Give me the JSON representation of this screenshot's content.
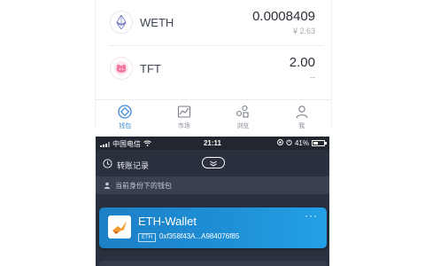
{
  "assets": [
    {
      "symbol": "WETH",
      "icon": "ethereum-icon",
      "amount": "0.0008409",
      "fiat": "¥ 2.63"
    },
    {
      "symbol": "TFT",
      "icon": "tft-token-icon",
      "amount": "2.00",
      "fiat": "--"
    }
  ],
  "tabbar": {
    "items": [
      {
        "label": "钱包",
        "icon": "wallet-icon",
        "active": true
      },
      {
        "label": "市场",
        "icon": "market-chart-icon",
        "active": false
      },
      {
        "label": "浏览",
        "icon": "browse-icon",
        "active": false
      },
      {
        "label": "我",
        "icon": "profile-icon",
        "active": false
      }
    ]
  },
  "statusbar": {
    "carrier": "中国电信",
    "time": "21:11",
    "battery": "41%",
    "battery_level": 0.41
  },
  "navbar": {
    "history_label": "转账记录"
  },
  "section": {
    "label": "当前身份下的钱包"
  },
  "wallet": {
    "name": "ETH-Wallet",
    "chain": "ETH",
    "address": "0xf358f43A...A984076f85",
    "more": "···"
  },
  "colors": {
    "accent": "#3d8bd4",
    "dark_bg": "#2a303e",
    "card_gradient_start": "#1c80c6",
    "card_gradient_end": "#22a0e6"
  }
}
